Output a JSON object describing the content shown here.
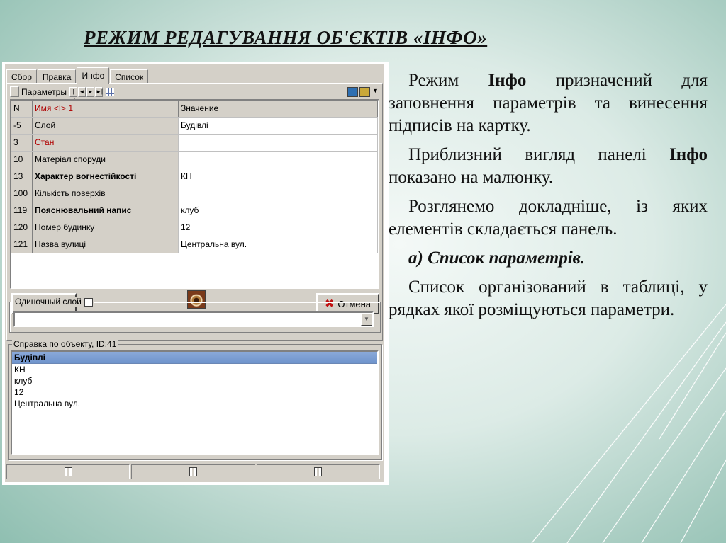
{
  "slide": {
    "title": "РЕЖИМ РЕДАГУВАННЯ ОБ'ЄКТІВ «ІНФО»",
    "paragraphs": {
      "p1_pre": "Режим ",
      "p1_bold": "Інфо",
      "p1_post": " призначений для заповнення параметрів та винесення підписів на картку.",
      "p2_pre": "Приблизний вигляд панелі ",
      "p2_bold": "Інфо",
      "p2_post": " показано на малюнку.",
      "p3": "Розглянемо докладніше, із яких елементів складається панель.",
      "p4": "а) Список параметрів.",
      "p5": "Список організований в таблиці, у рядках якої розміщуються параметри."
    }
  },
  "app": {
    "tabs": [
      {
        "label": "Сбор",
        "active": false
      },
      {
        "label": "Правка",
        "active": false
      },
      {
        "label": "Инфо",
        "active": true
      },
      {
        "label": "Список",
        "active": false
      }
    ],
    "toolbar": {
      "params_label": "Параметры",
      "menu_btn": "...",
      "nav": [
        "|◄",
        "◄",
        "►",
        "►|"
      ]
    },
    "table": {
      "header": {
        "n": "N",
        "name": "Имя <I> 1",
        "value": "Значение"
      },
      "rows": [
        {
          "n": "-5",
          "name": "Слой",
          "value": "Будівлі",
          "style": ""
        },
        {
          "n": "3",
          "name": "Стан",
          "value": "",
          "style": "red"
        },
        {
          "n": "10",
          "name": "Матеріал споруди",
          "value": "",
          "style": ""
        },
        {
          "n": "13",
          "name": "Характер вогнестійкості",
          "value": "КН",
          "style": "bold"
        },
        {
          "n": "100",
          "name": "Кількість поверхів",
          "value": "",
          "style": ""
        },
        {
          "n": "119",
          "name": "Пояснювальний напис",
          "value": "клуб",
          "style": "bold"
        },
        {
          "n": "120",
          "name": "Номер будинку",
          "value": "12",
          "style": ""
        },
        {
          "n": "121",
          "name": "Назва вулиці",
          "value": "Центральна вул.",
          "style": ""
        }
      ]
    },
    "buttons": {
      "ok": "OK",
      "cancel": "Отмена"
    },
    "single_layer_label": "Одиночный слой",
    "combo_value": "",
    "info_group_label": "Справка по объекту, ID:41",
    "info": {
      "head": "Будівлі",
      "lines": [
        "КН",
        "клуб",
        "12",
        "Центральна вул."
      ]
    }
  },
  "colors": {
    "window_bg": "#d4d0c8",
    "selection": "#6f94cc",
    "red_label": "#b00000",
    "ok_icon": "#1e8b1e",
    "cancel_icon": "#c01010"
  }
}
